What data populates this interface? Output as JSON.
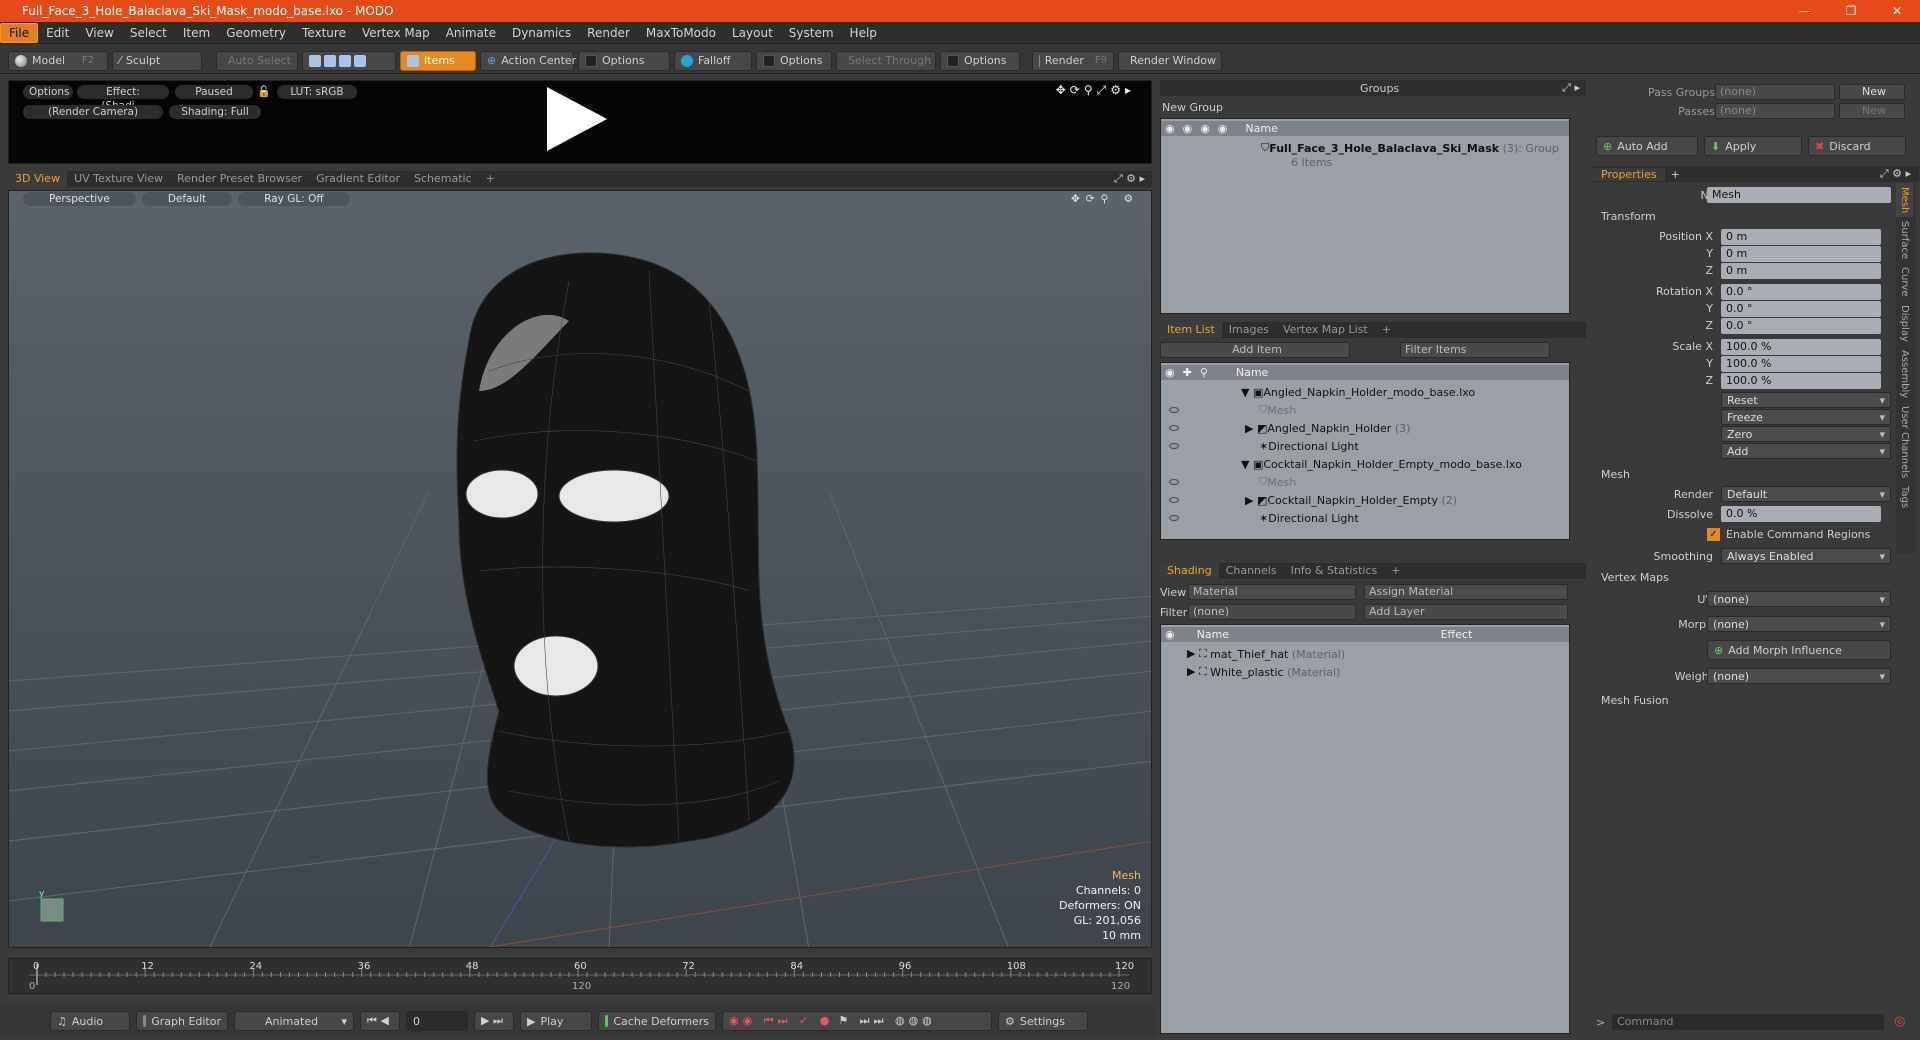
{
  "title": "Full_Face_3_Hole_Balaclava_Ski_Mask_modo_base.lxo - MODO",
  "window_controls": [
    "—",
    "❐",
    "✕"
  ],
  "menu": [
    "File",
    "Edit",
    "View",
    "Select",
    "Item",
    "Geometry",
    "Texture",
    "Vertex Map",
    "Animate",
    "Dynamics",
    "Render",
    "MaxToModo",
    "Layout",
    "System",
    "Help"
  ],
  "toolbar": {
    "model": "Model",
    "model_key": "F2",
    "sculpt": "Sculpt",
    "auto_select": "Auto Select",
    "items": "Items",
    "action_center": "Action Center",
    "options1": "Options",
    "falloff": "Falloff",
    "options2": "Options",
    "select_through": "Select Through",
    "options3": "Options",
    "render": "Render",
    "render_key": "F9",
    "render_window": "Render Window"
  },
  "preview": {
    "options": "Options",
    "effect": "Effect: (Shadi...",
    "paused": "Paused",
    "lut": "LUT: sRGB",
    "camera": "(Render Camera)",
    "shading": "Shading: Full"
  },
  "view_tabs": [
    "3D View",
    "UV Texture View",
    "Render Preset Browser",
    "Gradient Editor",
    "Schematic",
    "+"
  ],
  "viewport": {
    "perspective": "Perspective",
    "default": "Default",
    "raygl": "Ray GL: Off",
    "stats": {
      "mesh": "Mesh",
      "channels": "Channels: 0",
      "deformers": "Deformers: ON",
      "gl": "GL: 201,056",
      "unit": "10 mm"
    }
  },
  "timeline": {
    "ticks": [
      "0",
      "12",
      "24",
      "36",
      "48",
      "60",
      "72",
      "84",
      "96",
      "108",
      "120"
    ],
    "sub_start": "0",
    "sub_mid": "120",
    "sub_end": "120"
  },
  "bottom": {
    "audio": "Audio",
    "graph_editor": "Graph Editor",
    "animated": "Animated",
    "frame": "0",
    "play": "Play",
    "cache": "Cache Deformers",
    "settings": "Settings"
  },
  "groups": {
    "title": "Groups",
    "new_group": "New Group",
    "col_name": "Name",
    "item": "Full_Face_3_Hole_Balaclava_Ski_Mask",
    "item_count": "(3)",
    "item_type": ": Group",
    "sub": "6 Items"
  },
  "item_list": {
    "tabs": [
      "Item List",
      "Images",
      "Vertex Map List",
      "+"
    ],
    "add_item": "Add Item",
    "filter": "Filter Items",
    "col_name": "Name",
    "rows": [
      {
        "label": "Angled_Napkin_Holder_modo_base.lxo",
        "dim": ""
      },
      {
        "label": "Mesh",
        "dim": "g"
      },
      {
        "label": "Angled_Napkin_Holder",
        "count": "(3)"
      },
      {
        "label": "Directional Light"
      },
      {
        "label": "Cocktail_Napkin_Holder_Empty_modo_base.lxo"
      },
      {
        "label": "Mesh",
        "dim": "g"
      },
      {
        "label": "Cocktail_Napkin_Holder_Empty",
        "count": "(2)"
      },
      {
        "label": "Directional Light"
      }
    ]
  },
  "shading": {
    "tabs": [
      "Shading",
      "Channels",
      "Info & Statistics",
      "+"
    ],
    "view_label": "View",
    "view_value": "Material",
    "assign": "Assign Material",
    "filter_label": "Filter",
    "filter_value": "(none)",
    "add_layer": "Add Layer",
    "col_name": "Name",
    "col_effect": "Effect",
    "rows": [
      {
        "name": "mat_Thief_hat",
        "type": "(Material)"
      },
      {
        "name": "White_plastic",
        "type": "(Material)"
      }
    ]
  },
  "passes": {
    "pass_groups": "Pass Groups",
    "pass_groups_val": "(none)",
    "new1": "New",
    "passes": "Passes",
    "passes_val": "(none)",
    "new2": "New"
  },
  "actions": {
    "auto_add": "Auto Add",
    "apply": "Apply",
    "discard": "Discard"
  },
  "properties": {
    "tab": "Properties",
    "plus": "+",
    "name_label": "Name",
    "name_value": "Mesh",
    "transform": "Transform",
    "pos_label": "Position X",
    "px": "0 m",
    "py": "0 m",
    "pz": "0 m",
    "rot_label": "Rotation X",
    "rx": "0.0 °",
    "ry": "0.0 °",
    "rz": "0.0 °",
    "scale_label": "Scale X",
    "sx": "100.0 %",
    "sy": "100.0 %",
    "sz": "100.0 %",
    "y": "Y",
    "z": "Z",
    "reset": "Reset",
    "freeze": "Freeze",
    "zero": "Zero",
    "add": "Add",
    "mesh": "Mesh",
    "render_label": "Render",
    "render_val": "Default",
    "dissolve_label": "Dissolve",
    "dissolve_val": "0.0 %",
    "cmd_regions": "Enable Command Regions",
    "smoothing_label": "Smoothing",
    "smoothing_val": "Always Enabled",
    "vertex_maps": "Vertex Maps",
    "uv_label": "UV",
    "uv_val": "(none)",
    "morph_label": "Morph",
    "morph_val": "(none)",
    "add_morph": "Add Morph Influence",
    "weight_label": "Weight",
    "weight_val": "(none)",
    "mesh_fusion": "Mesh Fusion"
  },
  "side_tabs": [
    "Mesh",
    "Surface",
    "Curve",
    "Display",
    "Assembly",
    "User Channels",
    "Tags"
  ],
  "command": "Command",
  "colors": {
    "accent": "#e64a19",
    "orange": "#f0a02a",
    "panel": "#9aa0a5"
  }
}
